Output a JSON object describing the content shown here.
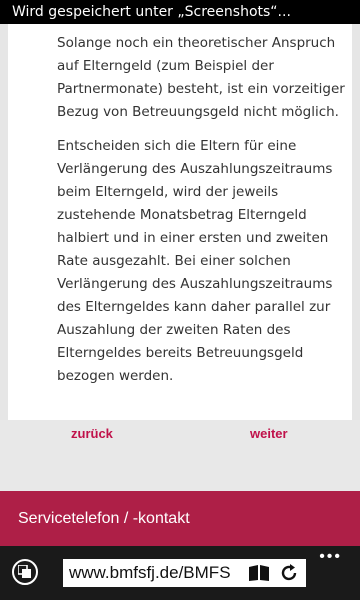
{
  "status_bar": {
    "text": "Wird gespeichert unter „Screenshots“..."
  },
  "article": {
    "paragraphs": [
      "Solange noch ein theoretischer Anspruch auf Elterngeld (zum Beispiel der Partnermonate) besteht, ist ein vorzeitiger Bezug von Betreuungsgeld nicht möglich.",
      "Entscheiden sich die Eltern für eine Verlängerung des Auszahlungszeitraums beim Elterngeld, wird der jeweils zustehende Monatsbetrag Elterngeld halbiert und in einer ersten und zweiten Rate ausgezahlt. Bei einer solchen Verlängerung des Auszahlungszeitraums des Elterngeldes kann daher parallel zur Auszahlung der zweiten Raten des Elterngeldes bereits Betreuungsgeld bezogen werden."
    ]
  },
  "nav": {
    "back_label": "zurück",
    "next_label": "weiter"
  },
  "service_bar": {
    "label": "Servicetelefon / -kontakt"
  },
  "browser": {
    "url": "www.bmfsfj.de/BMFS"
  },
  "colors": {
    "accent": "#ae1f47",
    "link": "#c0114a"
  }
}
